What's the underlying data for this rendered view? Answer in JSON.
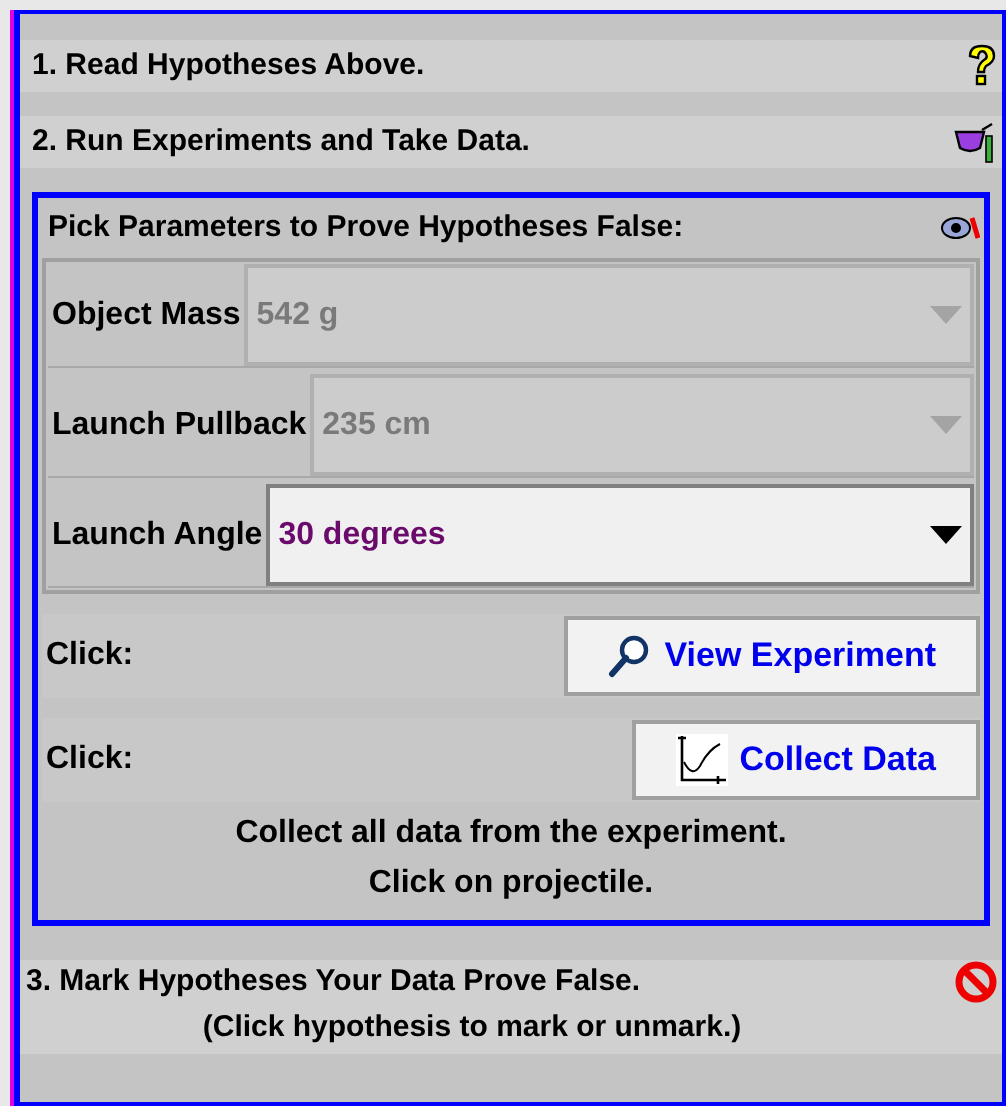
{
  "steps_top": [
    {
      "label": "1. Read Hypotheses Above.",
      "kind": "question"
    },
    {
      "label": "2. Run Experiments and Take Data.",
      "kind": "beaker"
    }
  ],
  "experiment_panel": {
    "title": "Pick Parameters to Prove Hypotheses False:",
    "parameters": [
      {
        "label": "Object Mass",
        "value": "542 g",
        "disabled": true
      },
      {
        "label": "Launch Pullback",
        "value": "235 cm",
        "disabled": true
      },
      {
        "label": "Launch Angle",
        "value": "30 degrees",
        "disabled": false
      }
    ],
    "actions": [
      {
        "prompt": "Click:",
        "button": "View Experiment",
        "kind": "view"
      },
      {
        "prompt": "Click:",
        "button": "Collect Data",
        "kind": "collect"
      }
    ],
    "instructions": [
      "Collect all data from the experiment.",
      "Click on projectile."
    ]
  },
  "step_bottom": {
    "label": "3. Mark Hypotheses Your Data Prove False.",
    "hint": "(Click hypothesis to mark or unmark.)",
    "kind": "mark"
  }
}
